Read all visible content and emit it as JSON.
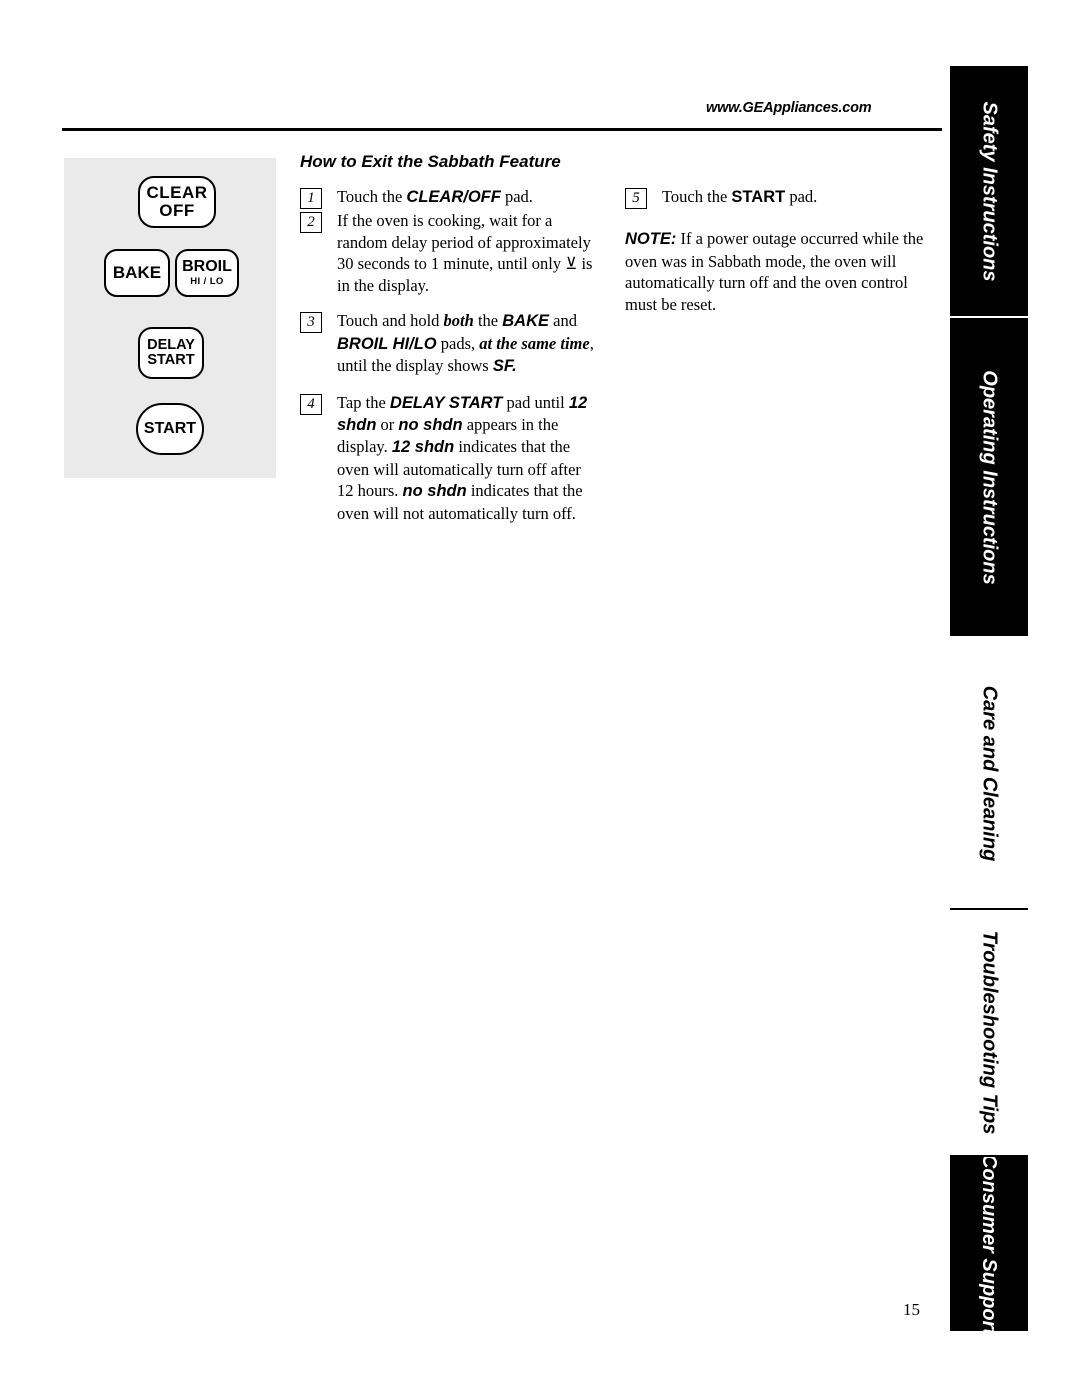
{
  "header": {
    "website": "www.GEAppliances.com"
  },
  "side_tabs": [
    {
      "label": "Safety Instructions",
      "style": "dark"
    },
    {
      "label": "Operating Instructions",
      "style": "dark"
    },
    {
      "label": "Care and Cleaning",
      "style": "light"
    },
    {
      "label": "Troubleshooting Tips",
      "style": "light"
    },
    {
      "label": "Consumer Support",
      "style": "dark"
    }
  ],
  "control_panel": {
    "clear_off_line1": "CLEAR",
    "clear_off_line2": "OFF",
    "bake": "BAKE",
    "broil": "BROIL",
    "broil_sub": "HI / LO",
    "delay_line1": "DELAY",
    "delay_line2": "START",
    "start": "START"
  },
  "content": {
    "heading": "How to Exit the Sabbath Feature",
    "steps_left": [
      {
        "number": "1",
        "text_html": "Touch the <b class=\"sansi\">CLEAR/OFF</b> pad."
      },
      {
        "number": "2",
        "text_html": "If the oven is cooking, wait for a random delay period of approximately 30 seconds to 1 minute, until only &#8891; is in the display."
      },
      {
        "number": "3",
        "text_html": "Touch and hold <i class=\"serifb\">both</i> the <b class=\"sansi\">BAKE</b> and <b class=\"sansi\">BROIL HI/LO</b> pads, <i class=\"serifb\">at the same time</i>, until the display shows <b class=\"sansi\">SF.</b>"
      },
      {
        "number": "4",
        "text_html": "Tap the <b class=\"sansi\">DELAY START</b> pad until <b class=\"sansi\">12 shdn</b> or <b class=\"sansi\">no shdn</b> appears in the display. <b class=\"sansi\">12 shdn</b> indicates that the oven will automatically turn off after 12 hours. <b class=\"sansi\">no shdn</b> indicates that the oven will not automatically turn off."
      }
    ],
    "steps_right": [
      {
        "number": "5",
        "text_html": "Touch the <b class=\"sans\">START</b> pad."
      }
    ],
    "note_html": "<b class=\"sansi\">NOTE:</b> If a power outage occurred while the oven was in Sabbath mode, the oven will automatically turn off and the oven control must be reset."
  },
  "page_number": "15"
}
